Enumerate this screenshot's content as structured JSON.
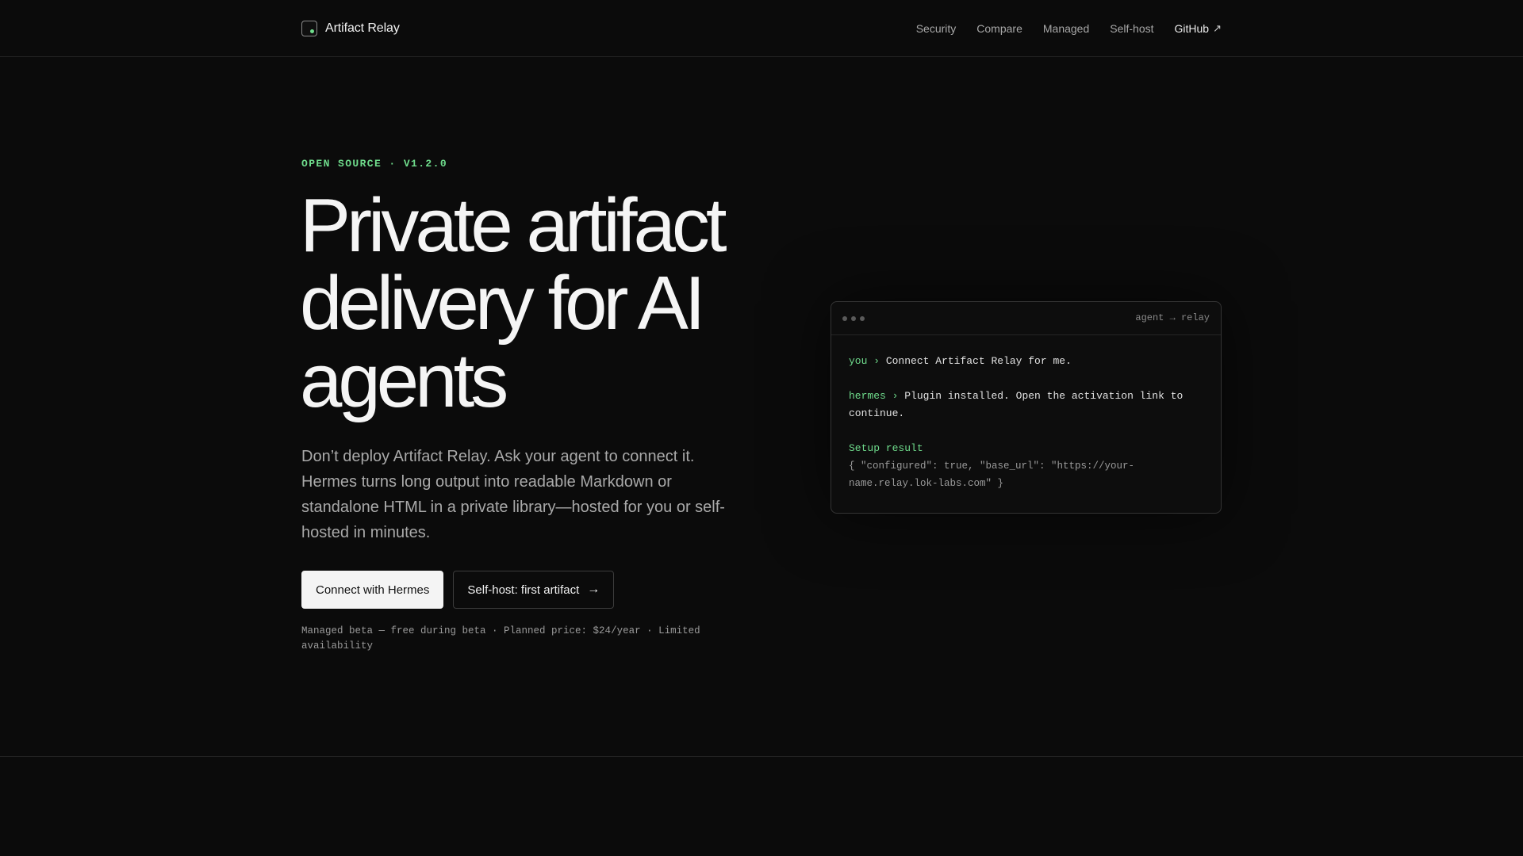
{
  "header": {
    "brand_name": "Artifact Relay",
    "nav": [
      {
        "label": "Security"
      },
      {
        "label": "Compare"
      },
      {
        "label": "Managed"
      },
      {
        "label": "Self-host"
      }
    ],
    "github_label": "GitHub",
    "github_icon": "external-arrow-icon"
  },
  "hero": {
    "eyebrow": "OPEN SOURCE · V1.2.0",
    "headline_lines": [
      "Private artifact",
      "delivery for AI",
      "agents"
    ],
    "lede": "Don’t deploy Artifact Relay. Ask your agent to connect it. Hermes turns long output into readable Markdown or standalone HTML in a private library—hosted for you or self-hosted in minutes.",
    "primary_cta": "Connect with Hermes",
    "secondary_cta": "Self-host: first artifact",
    "secondary_cta_arrow": "→",
    "fineprint": "Managed beta — free during beta · Planned price: $24/year · Limited availability"
  },
  "terminal": {
    "title": "agent → relay",
    "user_prompt": "you ›",
    "user_text": "Connect Artifact Relay for me.",
    "agent_prompt": "hermes ›",
    "agent_text": "Plugin installed. Open the activation link to continue.",
    "result_label": "Setup result",
    "result_json": "{ \"configured\": true, \"base_url\": \"https://your-name.relay.lok-labs.com\" }"
  },
  "colors": {
    "background": "#0b0b0b",
    "accent": "#6fdc8c",
    "text": "#f5f5f5",
    "muted": "#a9a9a9"
  }
}
